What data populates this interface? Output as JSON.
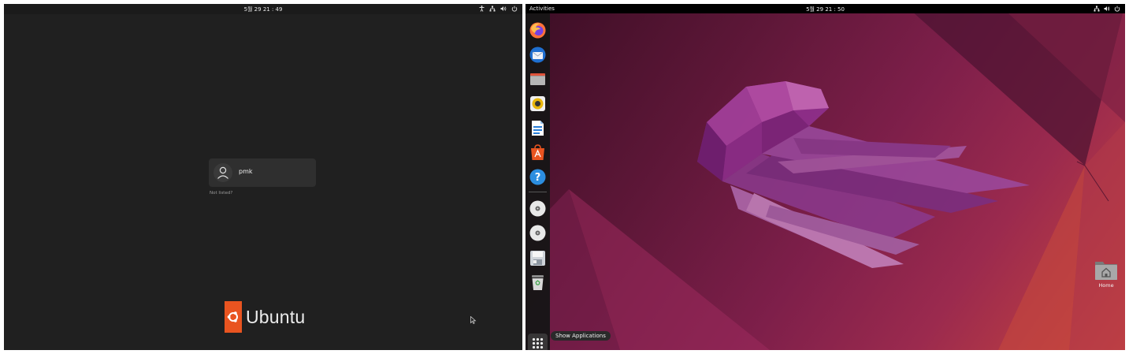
{
  "login_screen": {
    "clock": "5월 29  21 : 49",
    "user_name": "pmk",
    "not_listed": "Not listed?",
    "brand_name": "Ubuntu",
    "brand_color": "#e95420",
    "tray_icons": [
      "accessibility-icon",
      "network-icon",
      "volume-icon",
      "power-icon"
    ]
  },
  "desktop": {
    "activities_label": "Activities",
    "clock": "5월 29  21 : 50",
    "tray_icons": [
      "network-icon",
      "volume-icon",
      "power-icon"
    ],
    "dock": {
      "items": [
        {
          "name": "firefox-icon"
        },
        {
          "name": "thunderbird-icon"
        },
        {
          "name": "files-icon"
        },
        {
          "name": "rhythmbox-icon"
        },
        {
          "name": "libreoffice-writer-icon"
        },
        {
          "name": "ubuntu-software-icon"
        },
        {
          "name": "help-icon"
        },
        {
          "name": "optical-disc-icon"
        },
        {
          "name": "optical-disc-icon"
        },
        {
          "name": "floppy-drive-icon"
        },
        {
          "name": "trash-icon"
        }
      ],
      "show_apps_tooltip": "Show Applications"
    },
    "home_folder_label": "Home",
    "wallpaper_colors": [
      "#3c0e25",
      "#7e1f4a",
      "#c8443e"
    ]
  }
}
